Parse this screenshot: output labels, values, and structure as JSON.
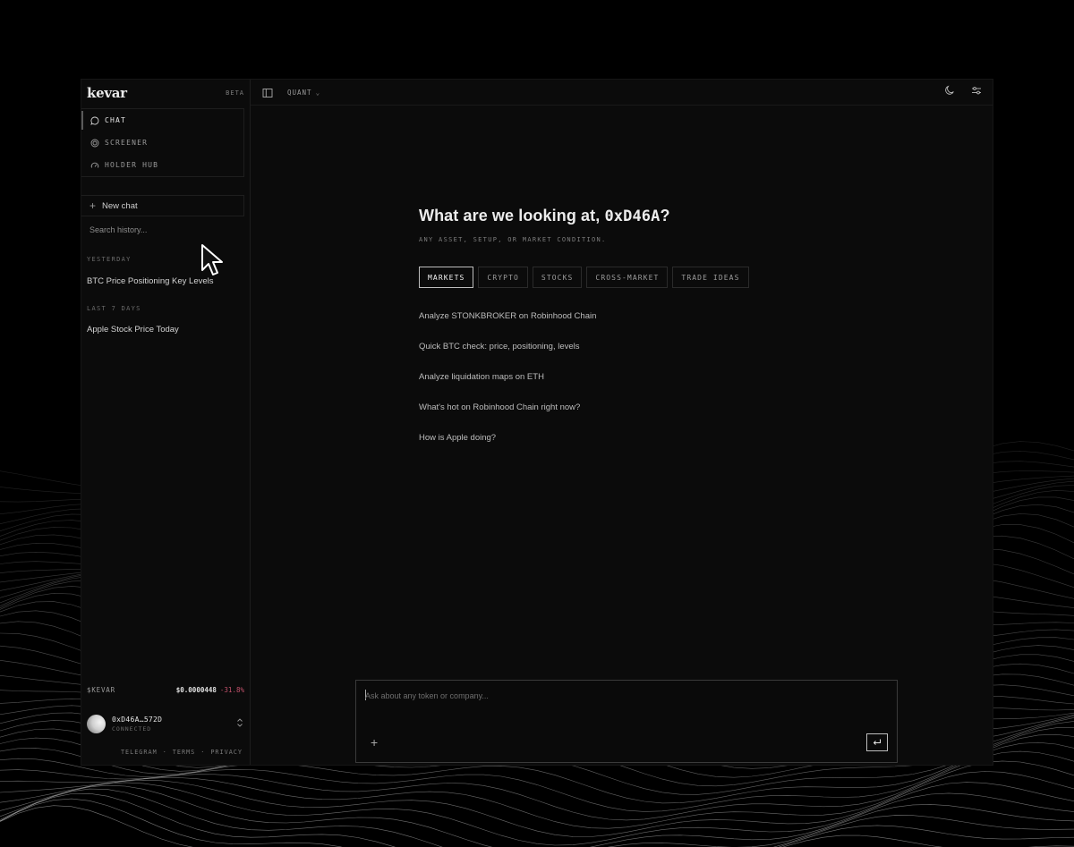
{
  "brand": {
    "name": "kevar",
    "badge": "BETA"
  },
  "nav": [
    {
      "label": "CHAT",
      "icon": "chat-bubble-icon",
      "active": true
    },
    {
      "label": "SCREENER",
      "icon": "target-icon",
      "active": false
    },
    {
      "label": "HOLDER HUB",
      "icon": "gauge-icon",
      "active": false
    }
  ],
  "sidebar": {
    "new_chat": "New chat",
    "search_placeholder": "Search history...",
    "history": [
      {
        "heading": "YESTERDAY",
        "items": [
          "BTC Price Positioning Key Levels"
        ]
      },
      {
        "heading": "LAST 7 DAYS",
        "items": [
          "Apple Stock Price Today"
        ]
      }
    ],
    "token": {
      "name": "$KEVAR",
      "price": "$0.0000448",
      "change": "-31.8%"
    },
    "wallet": {
      "address": "0xD46A…572D",
      "status": "CONNECTED"
    },
    "footer_links": [
      "TELEGRAM",
      "·",
      "TERMS",
      "·",
      "PRIVACY"
    ]
  },
  "topbar": {
    "mode": "QUANT",
    "icons": [
      "sidebar-toggle-icon",
      "moon-icon",
      "settings-sliders-icon"
    ]
  },
  "hero": {
    "greeting_prefix": "What are we looking at, ",
    "greeting_address": "0xD46A",
    "greeting_suffix": "?",
    "subtitle": "ANY ASSET, SETUP, OR MARKET CONDITION."
  },
  "tabs": [
    "MARKETS",
    "CRYPTO",
    "STOCKS",
    "CROSS-MARKET",
    "TRADE IDEAS"
  ],
  "active_tab": 0,
  "suggestions": [
    "Analyze STONKBROKER on Robinhood Chain",
    "Quick BTC check: price, positioning, levels",
    "Analyze liquidation maps on ETH",
    "What's hot on Robinhood Chain right now?",
    "How is Apple doing?"
  ],
  "composer": {
    "placeholder": "Ask about any token or company...",
    "attach_label": "+",
    "send_icon": "return-arrow-icon"
  },
  "colors": {
    "background": "#000000",
    "panel": "#0b0b0b",
    "accent_negative": "#c0506a"
  }
}
